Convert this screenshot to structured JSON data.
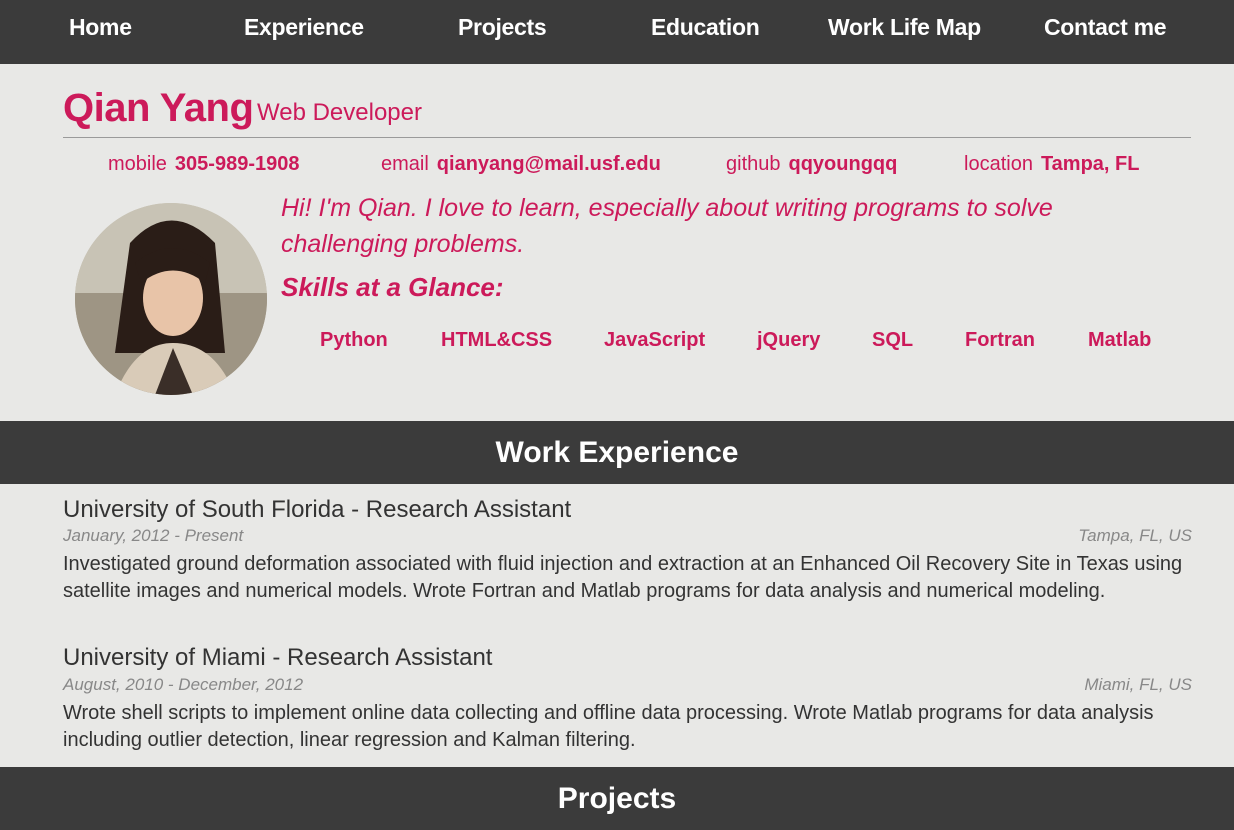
{
  "nav": {
    "items": [
      "Home",
      "Experience",
      "Projects",
      "Education",
      "Work Life Map",
      "Contact me"
    ]
  },
  "profile": {
    "name": "Qian Yang",
    "role": "Web Developer",
    "contacts": [
      {
        "label": "mobile",
        "value": "305-989-1908"
      },
      {
        "label": "email",
        "value": "qianyang@mail.usf.edu"
      },
      {
        "label": "github",
        "value": "qqyoungqq"
      },
      {
        "label": "location",
        "value": "Tampa, FL"
      }
    ],
    "intro": "Hi! I'm Qian. I love to learn, especially about writing programs to solve challenging problems.",
    "skills_title": "Skills at a Glance:",
    "skills": [
      "Python",
      "HTML&CSS",
      "JavaScript",
      "jQuery",
      "SQL",
      "Fortran",
      "Matlab"
    ]
  },
  "work": {
    "title": "Work Experience",
    "jobs": [
      {
        "title": "University of South Florida - Research Assistant",
        "dates": "January, 2012 - Present",
        "location": "Tampa, FL, US",
        "description": "Investigated ground deformation associated with fluid injection and extraction at an Enhanced Oil Recovery Site in Texas using satellite images and numerical models. Wrote Fortran and Matlab programs for data analysis and numerical modeling."
      },
      {
        "title": "University of Miami - Research Assistant",
        "dates": "August, 2010 - December, 2012",
        "location": "Miami, FL, US",
        "description": "Wrote shell scripts to implement online data collecting and offline data processing. Wrote Matlab programs for data analysis including outlier detection, linear regression and Kalman filtering."
      }
    ]
  },
  "projects": {
    "title": "Projects"
  },
  "colors": {
    "accent": "#cc1a5a",
    "bar": "#3b3b3b",
    "background": "#e8e8e6"
  }
}
